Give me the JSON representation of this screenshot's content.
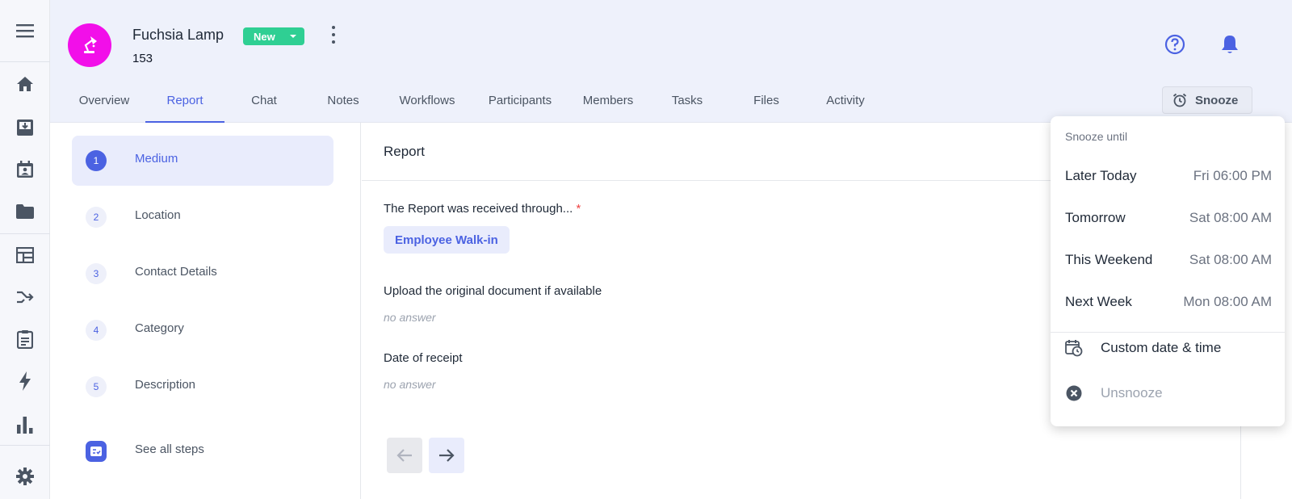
{
  "record": {
    "title": "Fuchsia Lamp",
    "id": "153",
    "status": "New",
    "avatar_color": "#f20fe9",
    "avatar_icon": "lamp-icon"
  },
  "rail": {
    "items": [
      "menu-icon",
      "home-icon",
      "inbox-icon",
      "calendar-contact-icon",
      "folder-icon",
      "dashboard-icon",
      "merge-icon",
      "clipboard-icon",
      "bolt-icon",
      "bar-chart-icon",
      "gear-icon"
    ]
  },
  "tabs": [
    {
      "label": "Overview"
    },
    {
      "label": "Report",
      "active": true
    },
    {
      "label": "Chat"
    },
    {
      "label": "Notes"
    },
    {
      "label": "Workflows"
    },
    {
      "label": "Participants"
    },
    {
      "label": "Members"
    },
    {
      "label": "Tasks"
    },
    {
      "label": "Files"
    },
    {
      "label": "Activity"
    }
  ],
  "snooze": {
    "button_label": "Snooze",
    "menu": {
      "header": "Snooze until",
      "options": [
        {
          "label": "Later Today",
          "time": "Fri 06:00 PM"
        },
        {
          "label": "Tomorrow",
          "time": "Sat 08:00 AM"
        },
        {
          "label": "This Weekend",
          "time": "Sat 08:00 AM"
        },
        {
          "label": "Next Week",
          "time": "Mon 08:00 AM"
        }
      ],
      "custom_label": "Custom date & time",
      "unsnooze_label": "Unsnooze"
    }
  },
  "steps": [
    {
      "num": "1",
      "label": "Medium",
      "active": true
    },
    {
      "num": "2",
      "label": "Location"
    },
    {
      "num": "3",
      "label": "Contact Details"
    },
    {
      "num": "4",
      "label": "Category"
    },
    {
      "num": "5",
      "label": "Description"
    }
  ],
  "see_all_label": "See all steps",
  "main": {
    "title": "Report",
    "questions": [
      {
        "label": "The Report was received through...",
        "required_mark": "*",
        "answer": "Employee Walk-in"
      },
      {
        "label": "Upload the original document if available",
        "answer": "no answer"
      },
      {
        "label": "Date of receipt",
        "answer": "no answer"
      }
    ]
  },
  "colors": {
    "accent": "#4b62e2",
    "status_green": "#2fcf93",
    "header_bg": "#eef1fb"
  }
}
